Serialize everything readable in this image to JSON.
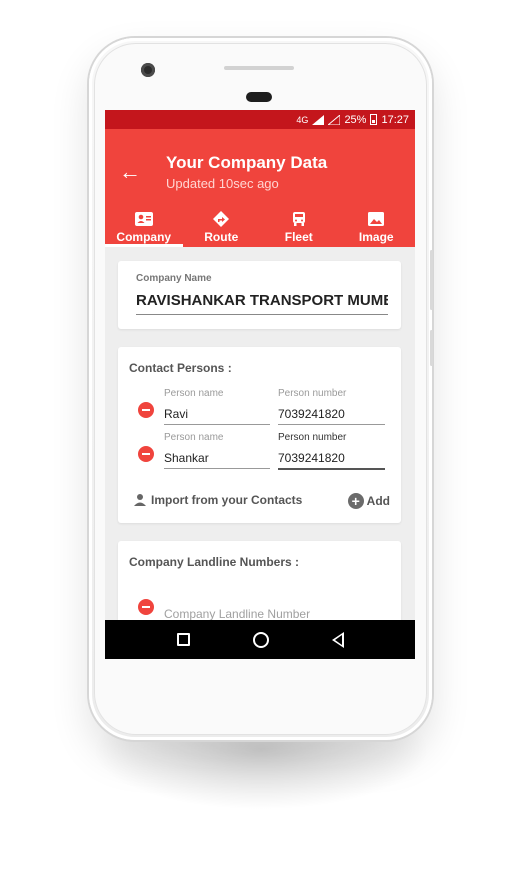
{
  "status_bar": {
    "network": "4G",
    "battery": "25%",
    "time": "17:27"
  },
  "app_bar": {
    "title": "Your Company Data",
    "subtitle": "Updated 10sec ago"
  },
  "tabs": [
    {
      "label": "Company",
      "icon": "contact-card-icon",
      "active": true
    },
    {
      "label": "Route",
      "icon": "directions-icon",
      "active": false
    },
    {
      "label": "Fleet",
      "icon": "bus-icon",
      "active": false
    },
    {
      "label": "Image",
      "icon": "image-icon",
      "active": false
    }
  ],
  "company": {
    "label": "Company Name",
    "value": "RAVISHANKAR TRANSPORT MUMBAI"
  },
  "contact_persons": {
    "title": "Contact Persons :",
    "rows": [
      {
        "name_label": "Person name",
        "name": "Ravi",
        "number_label": "Person number",
        "number": "7039241820"
      },
      {
        "name_label": "Person name",
        "name": "Shankar",
        "number_label": "Person number",
        "number": "7039241820"
      }
    ],
    "import_label": "Import from your Contacts",
    "add_label": "Add"
  },
  "landline": {
    "title": "Company Landline Numbers :",
    "placeholder": "Company Landline Number"
  },
  "colors": {
    "primary": "#f0443d",
    "status_bar": "#c4161c",
    "background": "#eeeeee"
  }
}
